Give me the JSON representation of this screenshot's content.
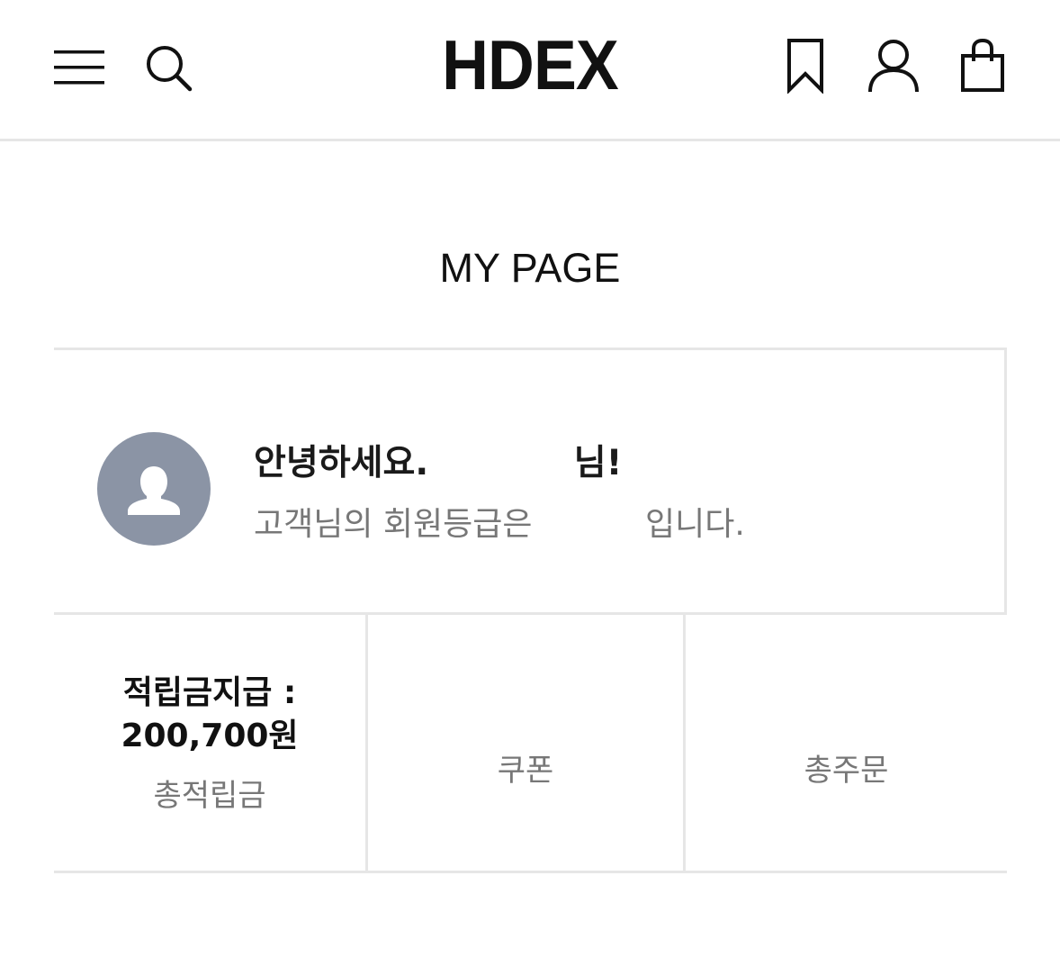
{
  "header": {
    "logo": "HDEX",
    "icons": {
      "menu": "hamburger-menu-icon",
      "search": "search-icon",
      "bookmark": "bookmark-icon",
      "user": "user-icon",
      "cart": "shopping-bag-icon"
    }
  },
  "page_title": "MY PAGE",
  "profile": {
    "greeting_prefix": "안녕하세요.",
    "user_name": "",
    "greeting_suffix": "님!",
    "grade_prefix": "고객님의 회원등급은",
    "grade_value": "",
    "grade_suffix": "입니다.",
    "avatar_color": "#8b94a5"
  },
  "stats": [
    {
      "value": "적립금지급 : 200,700원",
      "label": "총적립금"
    },
    {
      "value": "",
      "label": "쿠폰"
    },
    {
      "value": "",
      "label": "총주문"
    }
  ],
  "colors": {
    "divider": "#e6e6e6",
    "muted_text": "#777777",
    "primary_text": "#111111"
  }
}
